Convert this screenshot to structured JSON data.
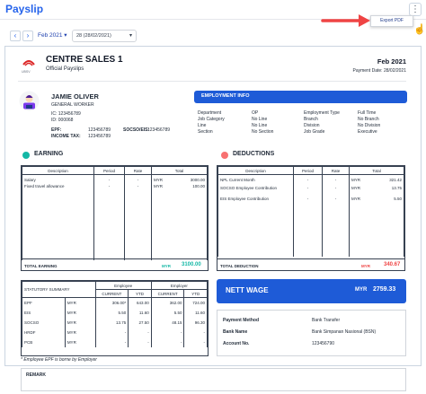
{
  "app": {
    "title": "Payslip",
    "more_icon": "kebab-icon",
    "export_label": "Export PDF"
  },
  "filters": {
    "month": "Feb 2021",
    "date_range": "28 (28/02/2021)"
  },
  "company": {
    "name": "CENTRE SALES 1",
    "subtitle": "Official Payslips",
    "logo_text": "UBSV",
    "period": "Feb 2021",
    "payment_date": "Payment Date: 28/02/2021"
  },
  "employee": {
    "name": "JAMIE OLIVER",
    "position": "GENERAL WORKER",
    "ic": "IC: 123456789",
    "id": "ID: 000068",
    "epf": "EPF:",
    "epf_value": "123456789",
    "socso_label": "SOCSO/EIS:",
    "socso_value": "123456789",
    "income_tax_label": "INCOME TAX:",
    "income_tax_value": "123456789"
  },
  "employment_info": {
    "header": "EMPLOYMENT INFO",
    "left": [
      {
        "label": "Department",
        "value": "OP"
      },
      {
        "label": "Job Category",
        "value": "No Line"
      },
      {
        "label": "Line",
        "value": "No Line"
      },
      {
        "label": "Section",
        "value": "No Section"
      }
    ],
    "right": [
      {
        "label": "Employment Type",
        "value": "Full Time"
      },
      {
        "label": "Branch",
        "value": "No Branch"
      },
      {
        "label": "Division",
        "value": "No Division"
      },
      {
        "label": "Job Grade",
        "value": "Executive"
      }
    ]
  },
  "earning": {
    "title": "EARNING",
    "color": "#14b8a6",
    "headers": [
      "Description",
      "Period",
      "Rate",
      "Total"
    ],
    "rows": [
      {
        "desc": "Salary",
        "period": "-",
        "rate": "-",
        "cur": "MYR",
        "total": "3000.00"
      },
      {
        "desc": "Fixed travel allowance",
        "period": "-",
        "rate": "-",
        "cur": "MYR",
        "total": "100.00"
      }
    ],
    "total_label": "TOTAL EARNING",
    "total_cur": "MYR",
    "total_value": "3100.00"
  },
  "deductions": {
    "title": "DEDUCTIONS",
    "color": "#f87171",
    "headers": [
      "Description",
      "Period",
      "Rate",
      "Total"
    ],
    "rows": [
      {
        "desc": "NPL Current Month",
        "period": "-",
        "rate": "-",
        "cur": "MYR",
        "total": "321.42"
      },
      {
        "desc": "SOCSO Employee Contribution",
        "period": "-",
        "rate": "-",
        "cur": "MYR",
        "total": "13.75"
      },
      {
        "desc": "EIS Employee Contribution",
        "period": "-",
        "rate": "-",
        "cur": "MYR",
        "total": "5.50"
      }
    ],
    "total_label": "TOTAL DEDUCTION",
    "total_cur": "MYR",
    "total_value": "340.67"
  },
  "statutory": {
    "title": "STATUTORY SUMMARY",
    "employee": "Employee",
    "employer": "Employer",
    "current": "CURRENT",
    "ytd": "YTD",
    "rows": [
      {
        "name": "EPF",
        "cur": "MYR",
        "ee_cur": "306.00",
        "ee_star": "*",
        "ee_ytd": "643.00",
        "er_cur": "362.00",
        "er_ytd": "724.00"
      },
      {
        "name": "EIS",
        "cur": "MYR",
        "ee_cur": "5.50",
        "ee_star": "",
        "ee_ytd": "11.60",
        "er_cur": "5.50",
        "er_ytd": "11.60"
      },
      {
        "name": "SOCSO",
        "cur": "MYR",
        "ee_cur": "13.75",
        "ee_star": "",
        "ee_ytd": "27.50",
        "er_cur": "48.15",
        "er_ytd": "96.30"
      },
      {
        "name": "HRDF",
        "cur": "MYR",
        "ee_cur": "-",
        "ee_star": "",
        "ee_ytd": "-",
        "er_cur": "-",
        "er_ytd": "-"
      },
      {
        "name": "PCB",
        "cur": "MYR",
        "ee_cur": "-",
        "ee_star": "",
        "ee_ytd": "-",
        "er_cur": "-",
        "er_ytd": "-"
      }
    ],
    "note": "* Employee EPF is borne by Employer"
  },
  "nett": {
    "label": "NETT WAGE",
    "cur": "MYR",
    "value": "2759.33"
  },
  "payment": [
    {
      "label": "Payment Method",
      "value": "Bank Transfer"
    },
    {
      "label": "Bank Name",
      "value": "Bank Simpanan Nasional (BSN)"
    },
    {
      "label": "Account No.",
      "value": "123456790"
    }
  ],
  "remark": {
    "label": "REMARK"
  }
}
